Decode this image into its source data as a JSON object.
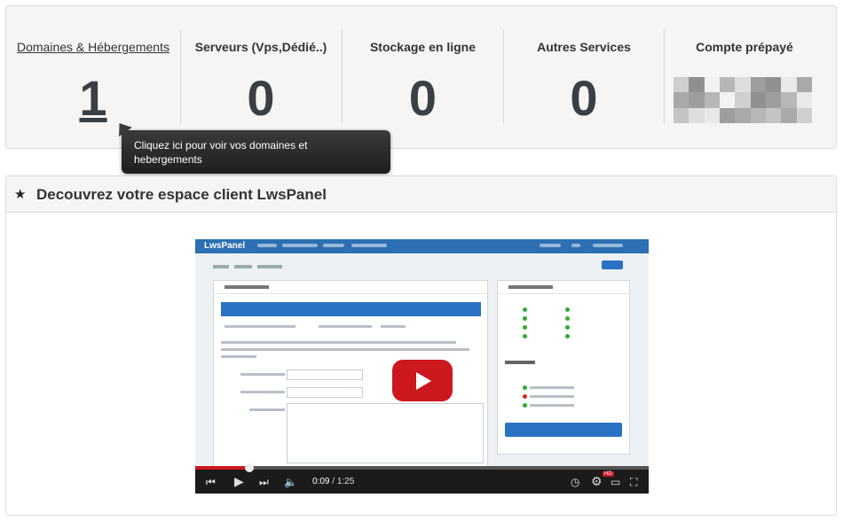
{
  "stats": {
    "items": [
      {
        "label": "Domaines & Hébergements",
        "value": "1"
      },
      {
        "label": "Serveurs (Vps,Dédié..)",
        "value": "0"
      },
      {
        "label": "Stockage en ligne",
        "value": "0"
      },
      {
        "label": "Autres Services",
        "value": "0"
      },
      {
        "label": "Compte prépayé"
      }
    ]
  },
  "tooltip": {
    "text": "Cliquez ici pour voir vos domaines et hebergements"
  },
  "discover": {
    "title": "Decouvrez votre espace client LwsPanel",
    "star_icon": "★"
  },
  "video": {
    "app_logo": "LwsPanel",
    "current_time": "0:09",
    "total_time": "1:25",
    "time_separator": " / ",
    "progress_fraction": 0.12,
    "icons": [
      "skip-back-icon",
      "play-icon",
      "skip-forward-icon",
      "volume-icon",
      "clock-icon",
      "settings-icon",
      "theater-icon",
      "fullscreen-icon"
    ],
    "hd_label": "HD"
  },
  "colors": {
    "accent_blue": "#2a72c4",
    "youtube_red": "#cc181e",
    "panel_bg": "#f5f5f5"
  }
}
